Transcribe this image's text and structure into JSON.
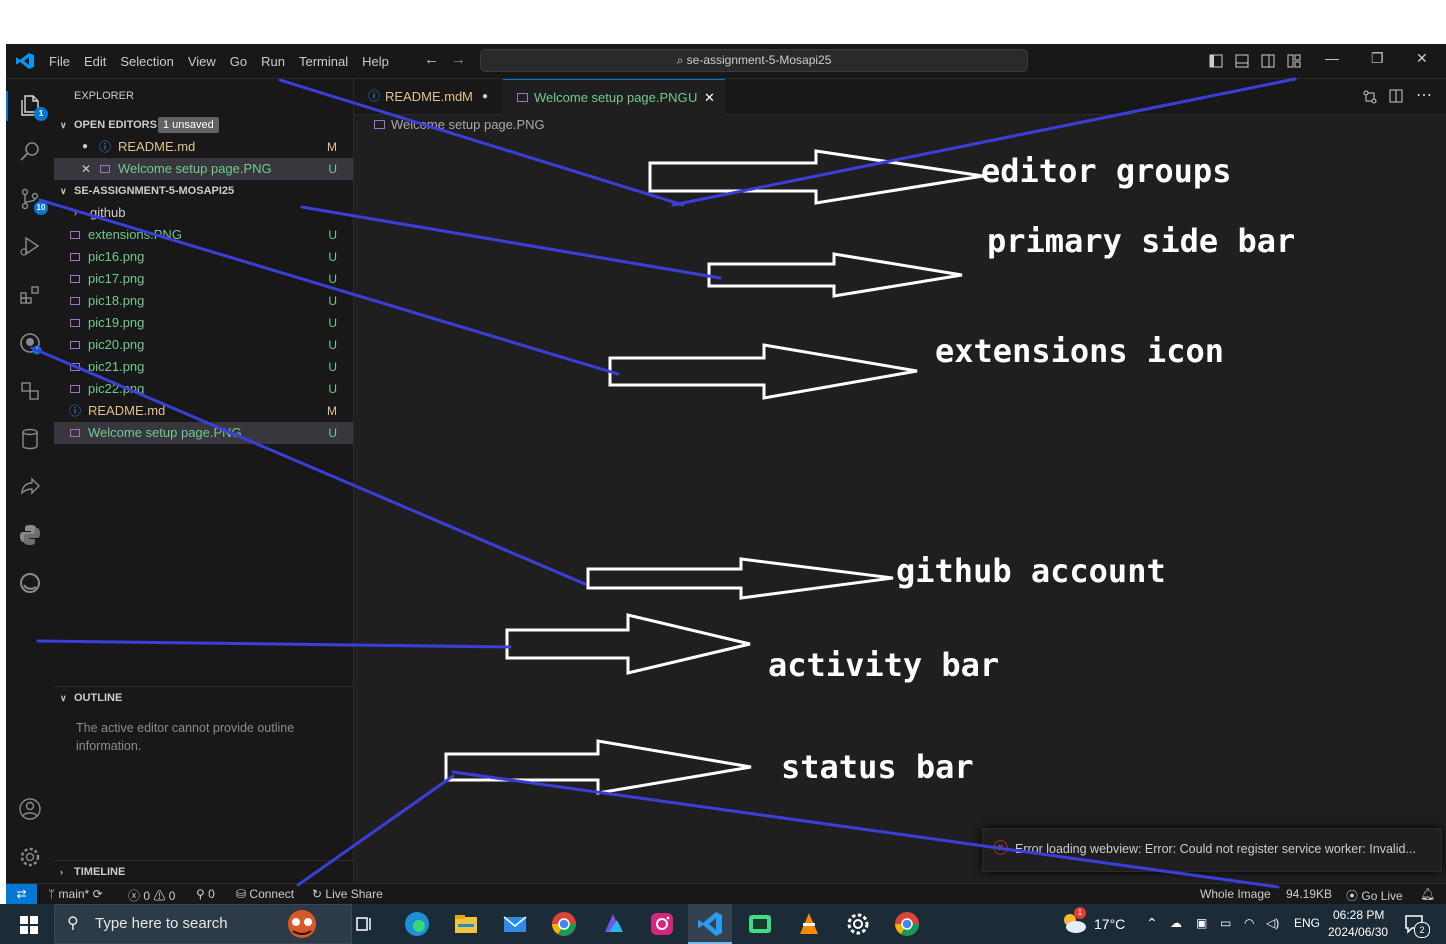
{
  "menu": [
    "File",
    "Edit",
    "Selection",
    "View",
    "Go",
    "Run",
    "Terminal",
    "Help"
  ],
  "command_center": "se-assignment-5-Mosapi25",
  "activity_badges": {
    "explorer": "1",
    "source_control": "10"
  },
  "sidebar": {
    "title": "EXPLORER",
    "open_editors_label": "OPEN EDITORS",
    "unsaved_badge": "1 unsaved",
    "open_editors": [
      {
        "name": "README.md",
        "status": "M",
        "prefix": "●"
      },
      {
        "name": "Welcome setup page.PNG",
        "status": "U",
        "prefix": "✕"
      }
    ],
    "folder_label": "SE-ASSIGNMENT-5-MOSAPI25",
    "files": [
      {
        "name": "github",
        "status": ""
      },
      {
        "name": "extensions.PNG",
        "status": "U"
      },
      {
        "name": "pic16.png",
        "status": "U"
      },
      {
        "name": "pic17.png",
        "status": "U"
      },
      {
        "name": "pic18.png",
        "status": "U"
      },
      {
        "name": "pic19.png",
        "status": "U"
      },
      {
        "name": "pic20.png",
        "status": "U"
      },
      {
        "name": "pic21.png",
        "status": "U"
      },
      {
        "name": "pic22.png",
        "status": "U"
      },
      {
        "name": "README.md",
        "status": "M"
      },
      {
        "name": "Welcome setup page.PNG",
        "status": "U"
      }
    ],
    "outline_label": "OUTLINE",
    "outline_message": "The active editor cannot provide outline information.",
    "timeline_label": "TIMELINE"
  },
  "tabs": [
    {
      "label": "README.md",
      "status": "M"
    },
    {
      "label": "Welcome setup page.PNG",
      "status": "U"
    }
  ],
  "breadcrumb": "Welcome setup page.PNG",
  "annotations": {
    "editor_groups": "editor groups",
    "primary_side_bar": "primary side bar",
    "extensions_icon": "extensions icon",
    "github_account": "github account",
    "activity_bar": "activity bar",
    "status_bar": "status bar"
  },
  "toast": "Error loading webview: Error: Could not register service worker: Invalid...",
  "statusbar": {
    "branch": "main*",
    "errors": "0",
    "warnings": "0",
    "ports": "0",
    "connect": "Connect",
    "live_share": "Live Share",
    "whole_image": "Whole Image",
    "size": "94.19KB",
    "go_live": "Go Live"
  },
  "taskbar": {
    "search_placeholder": "Type here to search",
    "temperature": "17°C",
    "language": "ENG",
    "time": "06:28 PM",
    "date": "2024/06/30",
    "notifications": "2",
    "weather_badge": "1"
  },
  "colors": {
    "accent": "#0078d4",
    "modified": "#e2c08d",
    "untracked": "#73c991",
    "annotation_line": "#3a3fd9"
  }
}
